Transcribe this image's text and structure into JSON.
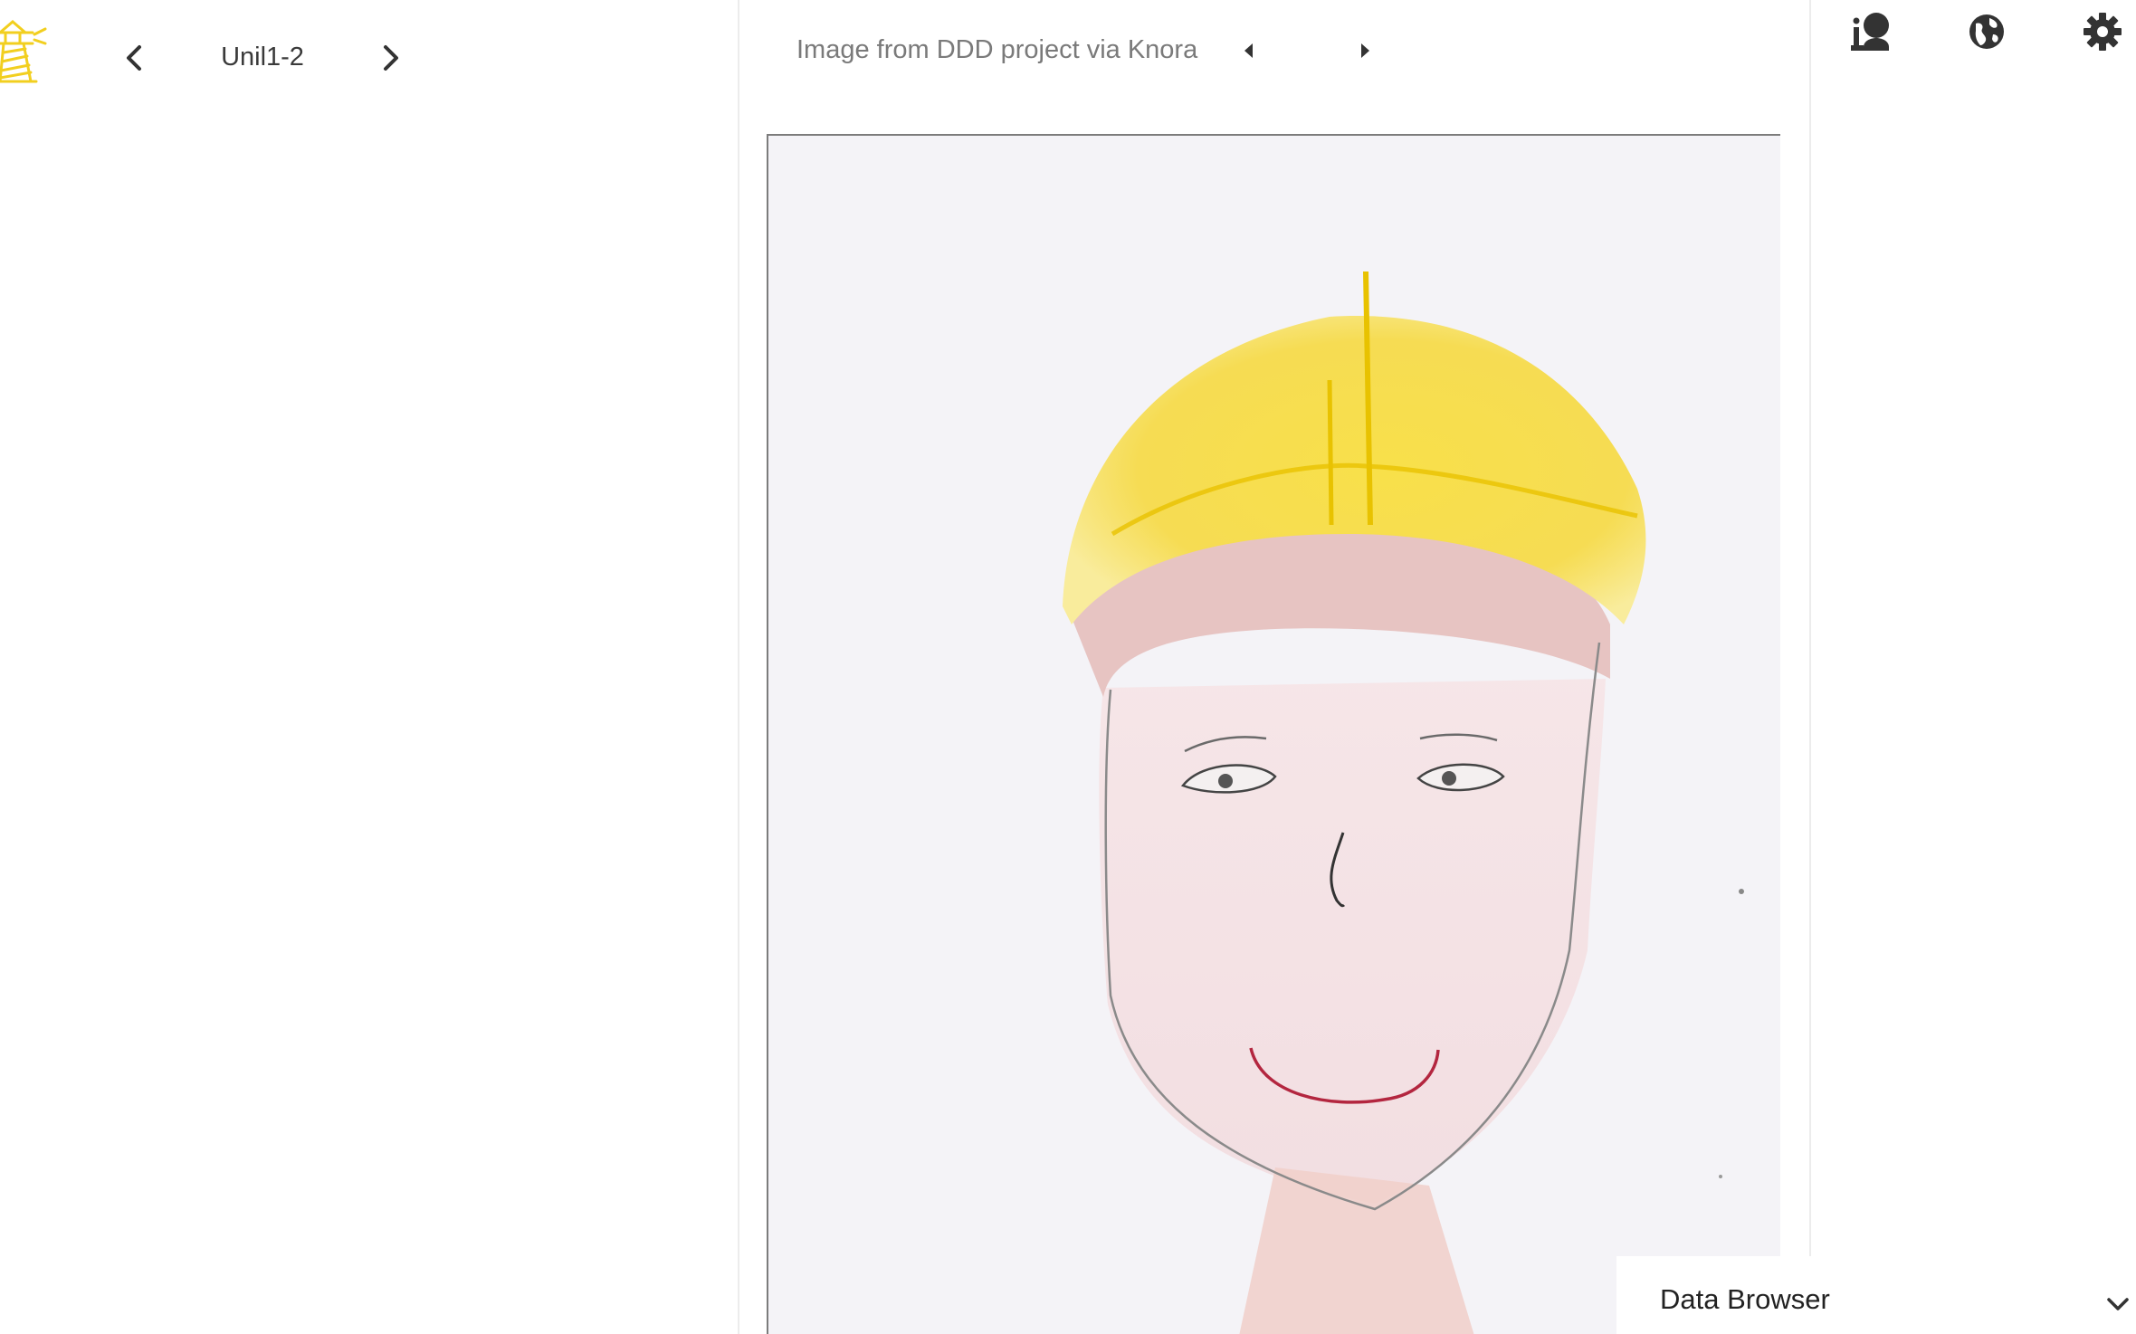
{
  "header": {
    "item_title": "Unil1-2"
  },
  "viewer": {
    "caption": "Image from DDD project via Knora"
  },
  "icons": {
    "logo": "lighthouse-logo",
    "prev_item": "chevron-left-icon",
    "next_item": "chevron-right-icon",
    "prev_image": "caret-left-icon",
    "next_image": "caret-right-icon",
    "info_user": "info-user-icon",
    "globe": "globe-icon",
    "settings": "gear-icon"
  },
  "data_browser": {
    "label": "Data Browser"
  },
  "colors": {
    "accent_yellow": "#f2cf1f",
    "icon_dark": "#333333",
    "caption_gray": "#7a7a7a"
  }
}
